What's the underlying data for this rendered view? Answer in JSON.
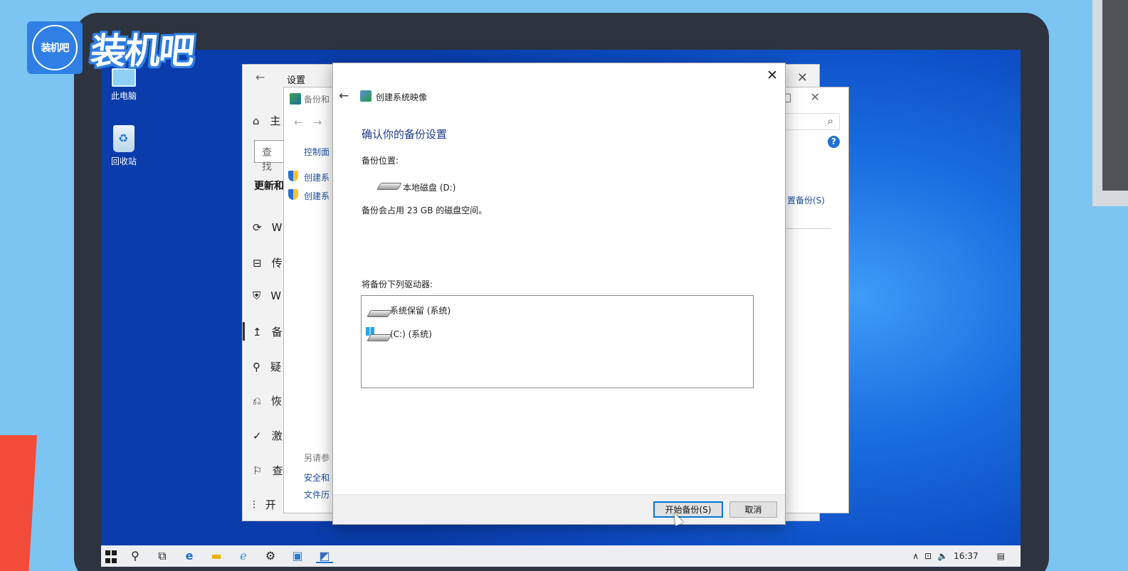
{
  "brand": {
    "badge_text": "装机吧",
    "wordmark": "装机吧"
  },
  "desktop": {
    "icons": [
      {
        "label": "此电脑",
        "icon": "computer-icon"
      },
      {
        "label": "回收站",
        "icon": "recycle-bin-icon"
      }
    ]
  },
  "settings_window": {
    "title": "设置",
    "home_label": "主",
    "search_placeholder": "查找",
    "section_heading": "更新和",
    "nav_items": [
      {
        "label": "W",
        "icon": "refresh-icon"
      },
      {
        "label": "传",
        "icon": "delivery-icon"
      },
      {
        "label": "W",
        "icon": "shield-icon"
      },
      {
        "label": "备",
        "icon": "backup-icon"
      },
      {
        "label": "疑",
        "icon": "wrench-icon"
      },
      {
        "label": "恢",
        "icon": "recovery-icon"
      },
      {
        "label": "激",
        "icon": "check-circle-icon"
      },
      {
        "label": "查",
        "icon": "find-device-icon"
      },
      {
        "label": "开",
        "icon": "developer-icon"
      }
    ]
  },
  "backup_window": {
    "title": "备份和",
    "breadcrumb": "控制面",
    "links": [
      "创建系",
      "创建系"
    ],
    "see_also": "另请参",
    "bottom_links": [
      "安全和",
      "文件历"
    ],
    "right_link": "置备份(S)",
    "help_glyph": "?"
  },
  "dialog": {
    "title": "创建系统映像",
    "heading": "确认你的备份设置",
    "location_label": "备份位置:",
    "location_value": "本地磁盘 (D:)",
    "space_note": "备份会占用 23 GB 的磁盘空间。",
    "drives_label": "将备份下列驱动器:",
    "drives": [
      {
        "label": "系统保留 (系统)",
        "icon": "drive-icon"
      },
      {
        "label": "(C:) (系统)",
        "icon": "windows-drive-icon"
      }
    ],
    "start_button": "开始备份(S)",
    "cancel_button": "取消",
    "close_glyph": "✕",
    "back_glyph": "←"
  },
  "taskbar": {
    "apps": [
      "search-icon",
      "task-view-icon",
      "edge-icon",
      "explorer-icon",
      "ie-icon",
      "settings-icon",
      "control-panel-icon",
      "system-image-icon"
    ],
    "time": "16:37"
  },
  "colors": {
    "background": "#7cc4f2",
    "heading_blue": "#1e3a8a",
    "link_blue": "#1a4fa0",
    "accent": "#0078d7"
  }
}
